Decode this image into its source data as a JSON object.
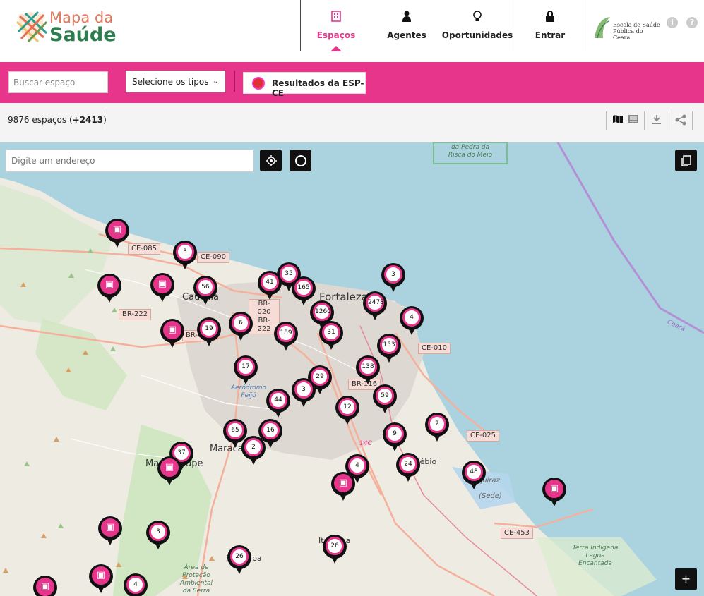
{
  "header": {
    "logo_top": "Mapa da",
    "logo_bottom": "Saúde",
    "nav": [
      {
        "label": "Espaços",
        "icon": "building-icon",
        "active": true
      },
      {
        "label": "Agentes",
        "icon": "person-icon",
        "active": false
      },
      {
        "label": "Oportunidades",
        "icon": "lightbulb-icon",
        "active": false
      },
      {
        "label": "Entrar",
        "icon": "lock-icon",
        "active": false
      }
    ],
    "partner_logo_text": "Escola de Saúde Pública do Ceará",
    "info_icon": "i",
    "help_icon": "?"
  },
  "filters": {
    "search_placeholder": "Buscar espaço",
    "type_select_value": "Selecione os tipos",
    "results_button_label": "Resultados da ESP-CE",
    "accent_color": "#e8358c"
  },
  "toolbar": {
    "count_main": "9876 espaços (",
    "count_extra": "+2413",
    "count_close": ")"
  },
  "map": {
    "address_placeholder": "Digite um endereço",
    "zoom_in": "+",
    "labels": {
      "fortaleza": "Fortaleza",
      "caucaia": "Caucaia",
      "maracanau": "Maracanaú",
      "maranguape": "Maranguape",
      "pacatuba": "Pacatuba",
      "itaitinga": "Itaitinga",
      "aquiraz": "Aquiraz",
      "aquiraz_sede": "(Sede)",
      "eusebio": "Eusébio",
      "aerodromo": "Aeródromo Feijó",
      "ceara": "Ceará",
      "terra_indigena": "Terra Indígena Lagoa Encantada",
      "area_protecao": "Área de Proteção Ambiental da Serra",
      "parque_pedra": "da Pedra da Risca do Meio"
    },
    "roads": [
      "CE-085",
      "CE-090",
      "BR-222",
      "BR-020 BR-222",
      "BR-020",
      "CE-010",
      "BR-116",
      "CE-025",
      "CE-453",
      "14C"
    ],
    "pins": [
      "3",
      "35",
      "41",
      "165",
      "56",
      "2478",
      "3",
      "1260",
      "6",
      "19",
      "31",
      "4",
      "189",
      "153",
      "17",
      "138",
      "29",
      "3",
      "44",
      "59",
      "12",
      "65",
      "16",
      "2",
      "9",
      "2",
      "37",
      "4",
      "24",
      "48",
      "3",
      "26",
      "26",
      "4"
    ]
  }
}
